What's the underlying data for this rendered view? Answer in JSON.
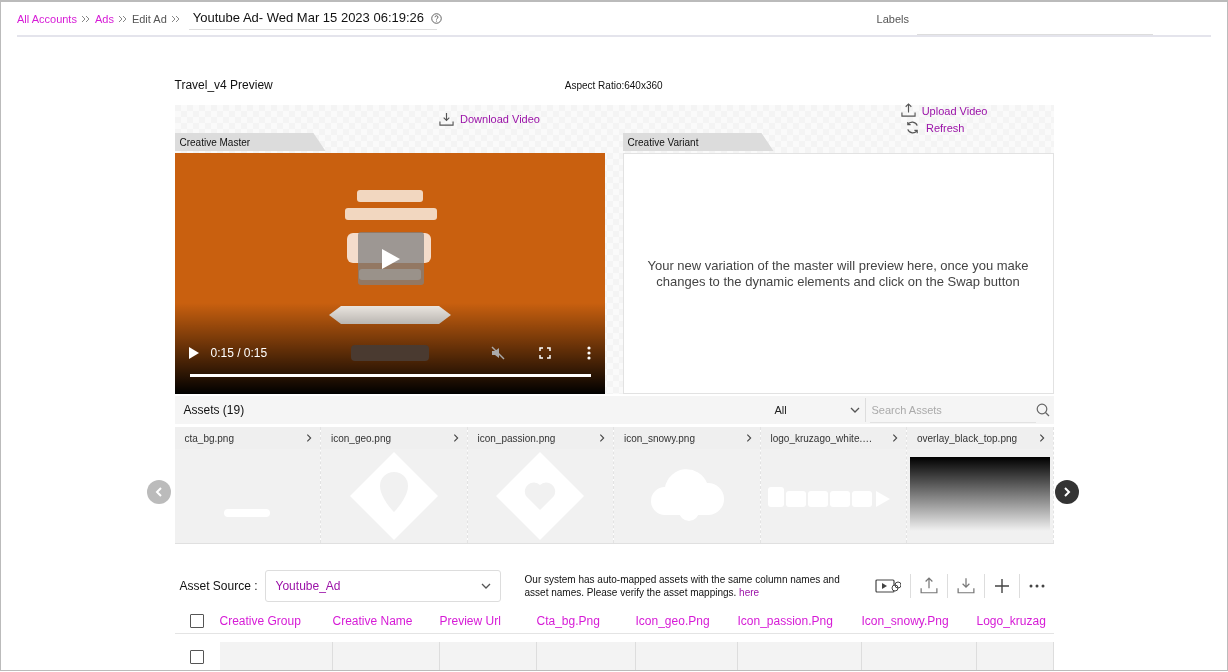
{
  "breadcrumb": [
    {
      "label": "All Accounts",
      "link": true
    },
    {
      "label": "Ads",
      "link": true
    },
    {
      "label": "Edit Ad",
      "link": false
    }
  ],
  "ad_title": "Youtube Ad- Wed Mar 15 2023 06:19:26",
  "labels": {
    "label": "Labels"
  },
  "preview": {
    "title": "Travel_v4 Preview",
    "aspect_ratio": "Aspect Ratio:640x360",
    "download": "Download Video",
    "upload": "Upload Video",
    "refresh": "Refresh",
    "master_tab": "Creative Master",
    "variant_tab": "Creative Variant",
    "player": {
      "time": "0:15 / 0:15",
      "muted": true,
      "level": 1
    },
    "variant_message": "Your new variation of the master will preview here, once you make changes to the dynamic elements and click on the Swap button"
  },
  "assets": {
    "title": "Assets (19)",
    "filter": "All",
    "search_placeholder": "Search Assets",
    "items": [
      {
        "name": "cta_bg.png",
        "kind": "dash"
      },
      {
        "name": "icon_geo.png",
        "kind": "pin"
      },
      {
        "name": "icon_passion.png",
        "kind": "heart"
      },
      {
        "name": "icon_snowy.png",
        "kind": "cloud"
      },
      {
        "name": "logo_kruzago_white.…",
        "kind": "logo"
      },
      {
        "name": "overlay_black_top.png",
        "kind": "gradient"
      }
    ]
  },
  "asset_source": {
    "label": "Asset Source :",
    "value": "Youtube_Ad",
    "note": "Our system has auto-mapped assets with the same column names and asset names. Please verify the asset mappings.",
    "note_link": "here"
  },
  "table": {
    "header_checked": false,
    "columns": [
      "Creative Group",
      "Creative Name",
      "Preview Url",
      "Cta_bg.Png",
      "Icon_geo.Png",
      "Icon_passion.Png",
      "Icon_snowy.Png",
      "Logo_kruzag"
    ],
    "rows": [
      {
        "checked": false
      }
    ]
  }
}
